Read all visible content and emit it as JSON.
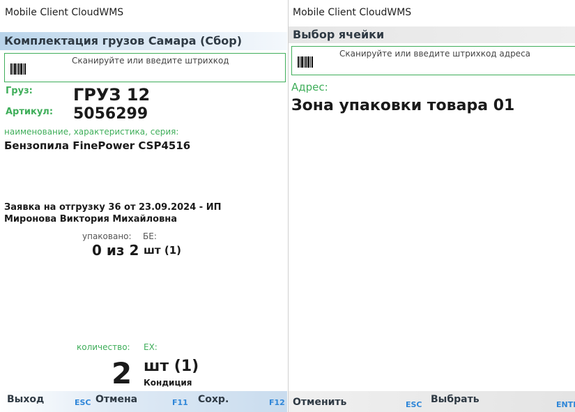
{
  "left": {
    "app_title": "Mobile Client CloudWMS",
    "screen_title": "Комплектация грузов Самара (Сбор)",
    "scan_hint": "Сканируйте или введите штрихкод",
    "cargo_label": "Груз:",
    "cargo_value": "ГРУЗ 12",
    "article_label": "Артикул:",
    "article_value": "5056299",
    "name_label": "наименование, характеристика, серия:",
    "name_value": "Бензопила FinePower CSP4516",
    "order_line1": "Заявка на отгрузку 36 от 23.09.2024 - ИП",
    "order_line2": "Миронова Виктория Михайловна",
    "packed_label": "упаковано:",
    "unit_label_top": "БЕ:",
    "packed_value": "0 из 2",
    "unit_top": "шт (1)",
    "qty_label": "количество:",
    "ex_label": "ЕХ:",
    "qty_value": "2",
    "qty_unit": "шт (1)",
    "condition": "Кондиция",
    "footer": [
      {
        "label": "Выход",
        "key": "ESC"
      },
      {
        "label": "Отмена",
        "key": "F11"
      },
      {
        "label": "Сохр.",
        "key": "F12"
      }
    ]
  },
  "right": {
    "app_title": "Mobile Client CloudWMS",
    "screen_title": "Выбор ячейки",
    "scan_hint": "Сканируйте или введите штрихкод адреса",
    "address_label": "Адрес:",
    "address_value": "Зона упаковки товара 01",
    "footer": [
      {
        "label": "Отменить",
        "key": "ESC"
      },
      {
        "label": "Выбрать",
        "key": "ENTER"
      }
    ]
  },
  "colors": {
    "accent_green": "#3fae5a",
    "key_blue": "#2e86d8",
    "title_bar": "#b9d4ea"
  },
  "icons": {
    "scan": "barcode-icon"
  }
}
